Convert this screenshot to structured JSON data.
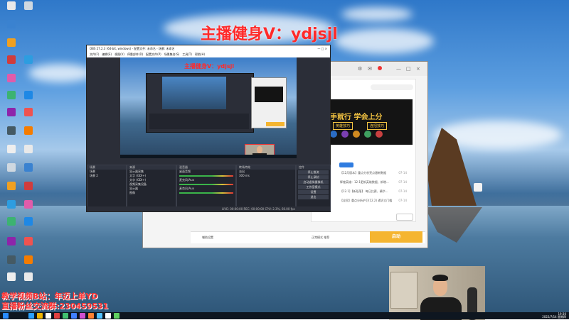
{
  "desktop": {
    "banner": "主播健身V：ydjsjl",
    "bottom_line1": "教学视频B站：年迈上单YD",
    "bottom_line2": "直播粉丝交流群:230459531",
    "icons": [
      {
        "label": "",
        "color": "#e9e9e9"
      },
      {
        "label": "",
        "color": "#cfd8e0"
      },
      {
        "label": "",
        "color": "#3a82d0"
      },
      {
        "label": "",
        "color": "#f0a020"
      },
      {
        "label": "",
        "color": "#d03c3c"
      },
      {
        "label": "",
        "color": "#2d9de0"
      },
      {
        "label": "",
        "color": "#e05caa"
      },
      {
        "label": "",
        "color": "#3cb371"
      },
      {
        "label": "",
        "color": "#1e88e5"
      },
      {
        "label": "",
        "color": "#8e24aa"
      },
      {
        "label": "",
        "color": "#ef5350"
      },
      {
        "label": "",
        "color": "#455a64"
      },
      {
        "label": "",
        "color": "#f57c00"
      },
      {
        "label": "",
        "color": "#eeeeee"
      }
    ]
  },
  "app": {
    "title_controls": [
      "—",
      "□",
      "×"
    ],
    "promo_title": "手就行 学会上分",
    "promo_tag1": "英雄技巧",
    "promo_tag2": "连招技巧",
    "list_items": [
      {
        "text": "【12月版本】重点分析亮点跟新数据",
        "time": "07-14"
      },
      {
        "text": "辉煌英雄：12.1更新英雄数据、新增...",
        "time": "07-14"
      },
      {
        "text": "【12.1]【新段落】 每日比赛、精华... ",
        "time": "07-14"
      },
      {
        "text": "【全民】重点分析护卫(12.2) 通识立门槛",
        "time": "07-14"
      }
    ],
    "footer_label": "辅助设置",
    "footer_mode": "正常模式 推荐",
    "start_label": "启动"
  },
  "obs": {
    "title": "OBS 27.2.3 (64-bit, windows) - 配置文件: 未命名 - 场景: 未命名",
    "menu": [
      "文件(F)",
      "编辑(E)",
      "视图(V)",
      "停靠部件(D)",
      "配置文件(P)",
      "场景集合(S)",
      "工具(T)",
      "帮助(H)"
    ],
    "docks": {
      "scenes_title": "场景",
      "scenes": [
        "场景",
        "场景 2"
      ],
      "sources_title": "来源",
      "sources": [
        "显示器采集",
        "文字 (GDI+)",
        "文字 (GDI+)",
        "视频采集设备",
        "显示器",
        "图像"
      ],
      "mixer_title": "混音器",
      "mixer": [
        "桌面音频",
        "麦克风/Aux",
        "麦克风/Aux"
      ],
      "transitions_title": "转场特效",
      "transition_value": "淡出",
      "transition_duration": "300 ms",
      "controls_title": "控件",
      "controls": [
        "停止推流",
        "停止录制",
        "启动虚拟摄像机",
        "工作室模式",
        "设置",
        "退出"
      ]
    },
    "status": "LIVE: 00:00:00   REC: 00:00:00   CPU: 2.3%, 60.00 fps"
  },
  "taskbar": {
    "time": "19:30",
    "date": "2022/7/14 星期四",
    "icons": [
      "#2aa0ff",
      "#f0b400",
      "#ffffff",
      "#e04040",
      "#40c070",
      "#4080ff",
      "#d050d0",
      "#ff8030",
      "#50c0ff",
      "#ffffff",
      "#60d060"
    ]
  }
}
